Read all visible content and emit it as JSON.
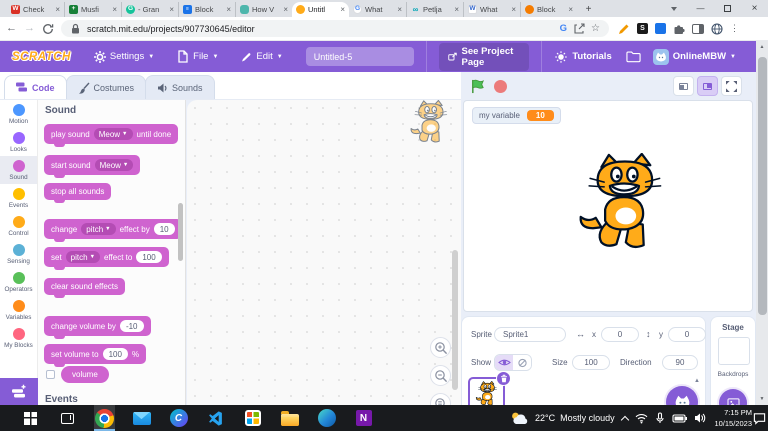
{
  "browser": {
    "tabs": [
      {
        "label": "Check",
        "icon": "writer"
      },
      {
        "label": "Musfi",
        "icon": "sheets"
      },
      {
        "label": "- Gran",
        "icon": "grammarly"
      },
      {
        "label": "Block",
        "icon": "docs"
      },
      {
        "label": "How V",
        "icon": "teal-app"
      },
      {
        "label": "Untitl",
        "icon": "scratch",
        "active": true
      },
      {
        "label": "What",
        "icon": "google"
      },
      {
        "label": "Petlja",
        "icon": "petlja"
      },
      {
        "label": "What",
        "icon": "wikipedia"
      },
      {
        "label": "Block",
        "icon": "orange-app"
      }
    ],
    "url": "scratch.mit.edu/projects/907730645/editor"
  },
  "menu_bar": {
    "logo": "SCRATCH",
    "settings": "Settings",
    "file": "File",
    "edit": "Edit",
    "project_name": "Untitled-5",
    "see_project_page": "See Project Page",
    "tutorials": "Tutorials",
    "username": "OnlineMBW"
  },
  "editor_tabs": [
    {
      "label": "Code",
      "icon": "code-blocks",
      "active": true
    },
    {
      "label": "Costumes",
      "icon": "brush",
      "active": false
    },
    {
      "label": "Sounds",
      "icon": "speaker",
      "active": false
    }
  ],
  "categories": [
    {
      "name": "Motion",
      "color": "#4C97FF"
    },
    {
      "name": "Looks",
      "color": "#9966FF"
    },
    {
      "name": "Sound",
      "color": "#CF63CF",
      "selected": true
    },
    {
      "name": "Events",
      "color": "#FFBF00"
    },
    {
      "name": "Control",
      "color": "#FFAB19"
    },
    {
      "name": "Sensing",
      "color": "#5CB1D6"
    },
    {
      "name": "Operators",
      "color": "#59C059"
    },
    {
      "name": "Variables",
      "color": "#FF8C1A"
    },
    {
      "name": "My Blocks",
      "color": "#FF6680"
    }
  ],
  "palette": {
    "section_header": "Sound",
    "next_section_header": "Events",
    "blocks": [
      {
        "type": "stack",
        "parts": [
          [
            "label",
            "play sound"
          ],
          [
            "dropdown",
            "Meow"
          ],
          [
            "label",
            "until done"
          ]
        ]
      },
      {
        "type": "stack",
        "parts": [
          [
            "label",
            "start sound"
          ],
          [
            "dropdown",
            "Meow"
          ]
        ]
      },
      {
        "type": "stack",
        "parts": [
          [
            "label",
            "stop all sounds"
          ]
        ]
      },
      {
        "type": "stack",
        "parts": [
          [
            "label",
            "change"
          ],
          [
            "dropdown",
            "pitch"
          ],
          [
            "label",
            "effect by"
          ],
          [
            "input",
            "10"
          ]
        ]
      },
      {
        "type": "stack",
        "parts": [
          [
            "label",
            "set"
          ],
          [
            "dropdown",
            "pitch"
          ],
          [
            "label",
            "effect to"
          ],
          [
            "input",
            "100"
          ]
        ]
      },
      {
        "type": "stack",
        "parts": [
          [
            "label",
            "clear sound effects"
          ]
        ]
      },
      {
        "type": "stack",
        "parts": [
          [
            "label",
            "change volume by"
          ],
          [
            "input",
            "-10"
          ]
        ]
      },
      {
        "type": "stack",
        "parts": [
          [
            "label",
            "set volume to"
          ],
          [
            "input",
            "100"
          ],
          [
            "label",
            "%"
          ]
        ]
      },
      {
        "type": "reporter",
        "checkbox": true,
        "parts": [
          [
            "label",
            "volume"
          ]
        ]
      }
    ]
  },
  "stage": {
    "monitor_label": "my variable",
    "monitor_value": "10"
  },
  "sprite_panel": {
    "sprite_label": "Sprite",
    "sprite_name": "Sprite1",
    "x_label": "x",
    "x_value": "0",
    "y_label": "y",
    "y_value": "0",
    "show_label": "Show",
    "size_label": "Size",
    "size_value": "100",
    "direction_label": "Direction",
    "direction_value": "90"
  },
  "stage_panel": {
    "stage_label": "Stage",
    "backdrops_label": "Backdrops"
  },
  "taskbar": {
    "apps": [
      "start",
      "task-view",
      "chrome",
      "mail",
      "canva",
      "vscode",
      "store",
      "explorer",
      "edge",
      "onenote"
    ],
    "active_app": "chrome",
    "weather_temp": "22°C",
    "weather_condition": "Mostly cloudy",
    "time": "7:15 PM",
    "date": "10/15/2023"
  },
  "colors": {
    "scratch_purple": "#855CD6",
    "sound_block": "#CF63CF",
    "monitor_orange": "#FF8C1A"
  }
}
